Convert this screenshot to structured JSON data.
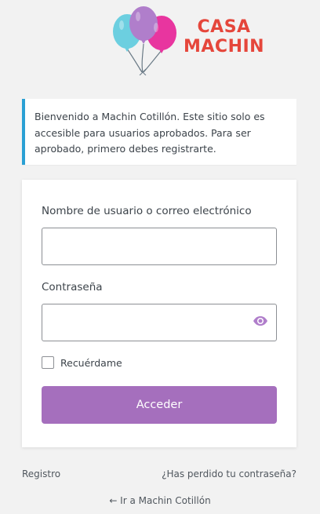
{
  "brand": {
    "line1": "CASA",
    "line2": "MACHIN",
    "colors": {
      "text": "#e5463b",
      "balloon_blue": "#6ccfe0",
      "balloon_purple": "#b07ecb",
      "balloon_pink": "#e8359f"
    }
  },
  "message": {
    "text": "Bienvenido a Machin Cotillón. Este sitio solo es accesible para usuarios aprobados. Para ser aprobado, primero debes registrarte.",
    "accent_color": "#2aa0d4"
  },
  "form": {
    "username_label": "Nombre de usuario o correo electrónico",
    "username_value": "",
    "password_label": "Contraseña",
    "password_value": "",
    "show_password_icon": "eye-icon",
    "remember_label": "Recuérdame",
    "remember_checked": false,
    "submit_label": "Acceder",
    "submit_color": "#a56fbd"
  },
  "nav": {
    "register": "Registro",
    "lost_password": "¿Has perdido tu contraseña?"
  },
  "backlink": "← Ir a Machin Cotillón"
}
